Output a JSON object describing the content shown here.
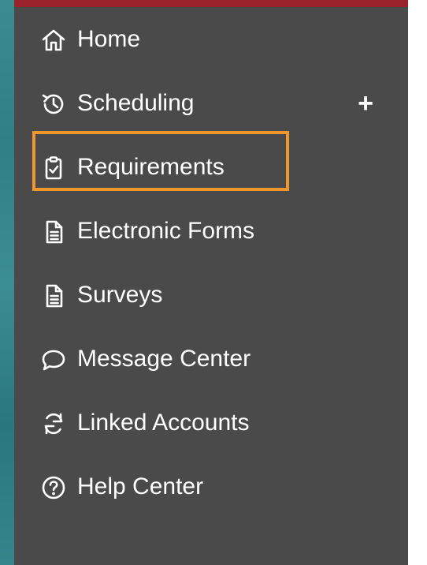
{
  "menu": {
    "items": [
      {
        "label": "Home",
        "icon": "home-icon"
      },
      {
        "label": "Scheduling",
        "icon": "history-icon",
        "expand": "+"
      },
      {
        "label": "Requirements",
        "icon": "clipboard-check-icon"
      },
      {
        "label": "Electronic Forms",
        "icon": "document-icon"
      },
      {
        "label": "Surveys",
        "icon": "document-icon"
      },
      {
        "label": "Message Center",
        "icon": "chat-bubble-icon"
      },
      {
        "label": "Linked Accounts",
        "icon": "sync-icon"
      },
      {
        "label": "Help Center",
        "icon": "question-circle-icon"
      }
    ]
  },
  "colors": {
    "panel_bg": "#4a4a4a",
    "top_bar": "#9a232b",
    "highlight": "#f0962f",
    "text": "#ffffff"
  }
}
